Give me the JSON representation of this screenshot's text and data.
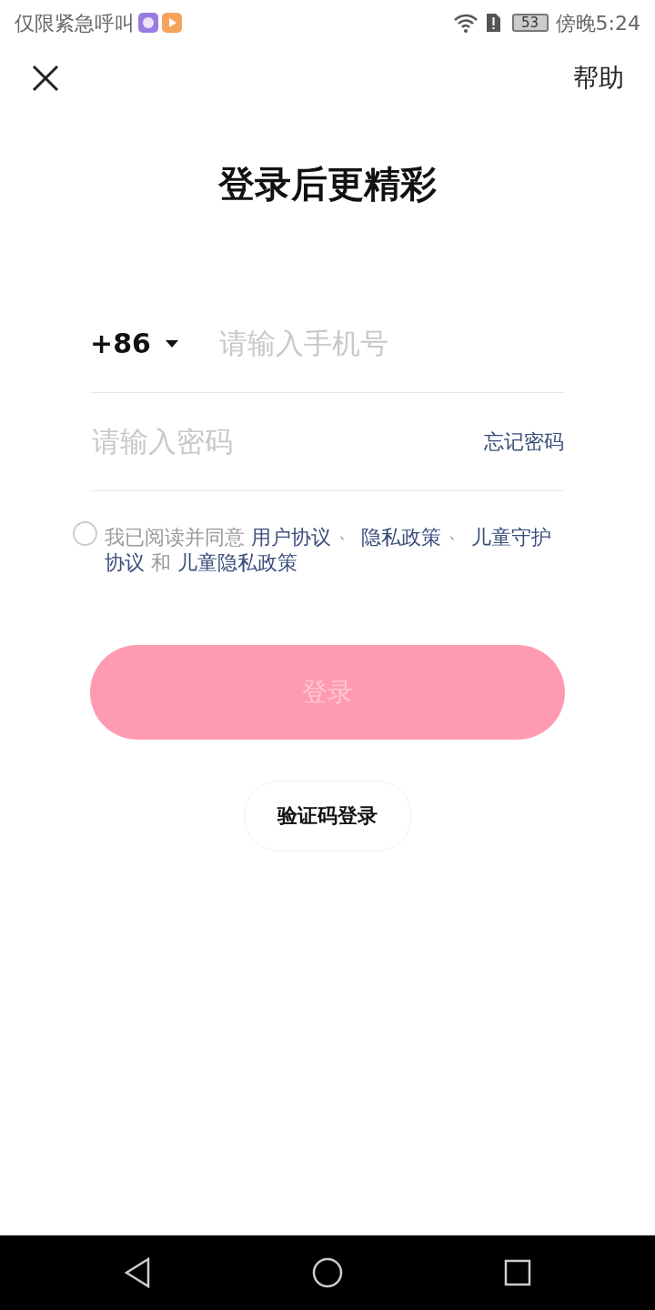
{
  "status_bar": {
    "carrier": "仅限紧急呼叫",
    "battery": "53",
    "time": "傍晚5:24"
  },
  "header": {
    "help": "帮助"
  },
  "title": "登录后更精彩",
  "phone": {
    "country_code": "+86",
    "placeholder": "请输入手机号"
  },
  "password": {
    "placeholder": "请输入密码",
    "forgot": "忘记密码"
  },
  "agreement": {
    "checked": false,
    "parts": [
      {
        "kind": "text",
        "text": "我已阅读并同意 "
      },
      {
        "kind": "link",
        "text": "用户协议"
      },
      {
        "kind": "separator",
        "text": " 、"
      },
      {
        "kind": "link",
        "text": "隐私政策"
      },
      {
        "kind": "separator",
        "text": " 、"
      },
      {
        "kind": "link",
        "text": "儿童守护"
      },
      {
        "kind": "link",
        "text": "协议"
      },
      {
        "kind": "text",
        "text": " 和 "
      },
      {
        "kind": "link",
        "text": "儿童隐私政策"
      }
    ]
  },
  "login_button": {
    "label": "登录",
    "disabled": true
  },
  "sms_button": {
    "label": "验证码登录"
  }
}
